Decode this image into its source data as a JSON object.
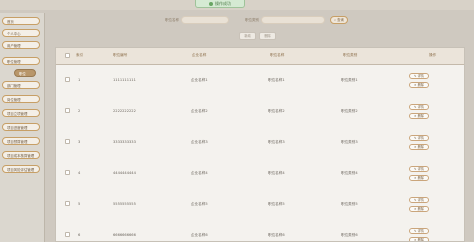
{
  "toast": {
    "message": "操作成功"
  },
  "sidebar": {
    "items": [
      {
        "label": "首页",
        "active": false
      },
      {
        "label": "个人中心",
        "active": false
      },
      {
        "label": "用户管理",
        "active": false
      },
      {
        "label": "职位管理",
        "active": false
      },
      {
        "label": "职位",
        "active": true
      },
      {
        "label": "部门管理",
        "active": false
      },
      {
        "label": "岗位管理",
        "active": false
      },
      {
        "label": "项目立项管理",
        "active": false
      },
      {
        "label": "项目进度管理",
        "active": false
      },
      {
        "label": "项目预算管理",
        "active": false
      },
      {
        "label": "项目成本核算管理",
        "active": false
      },
      {
        "label": "项目风险评估管理",
        "active": false
      }
    ]
  },
  "search": {
    "field1_label": "职位名称",
    "field2_label": "职位类别",
    "button_label": "查询"
  },
  "actions": {
    "add_label": "新增",
    "delete_label": "删除"
  },
  "table": {
    "headers": [
      "索引",
      "职位编号",
      "企业名称",
      "职位名称",
      "职位类别",
      "操作"
    ],
    "rows": [
      {
        "index": "1",
        "code": "1111111111",
        "company": "企业名称1",
        "position": "职位名称1",
        "category": "职位类别1"
      },
      {
        "index": "2",
        "code": "2222222222",
        "company": "企业名称2",
        "position": "职位名称2",
        "category": "职位类别2"
      },
      {
        "index": "3",
        "code": "3333333333",
        "company": "企业名称3",
        "position": "职位名称3",
        "category": "职位类别3"
      },
      {
        "index": "4",
        "code": "4444444444",
        "company": "企业名称4",
        "position": "职位名称4",
        "category": "职位类别4"
      },
      {
        "index": "5",
        "code": "5555555555",
        "company": "企业名称5",
        "position": "职位名称5",
        "category": "职位类别5"
      },
      {
        "index": "6",
        "code": "6666666666",
        "company": "企业名称6",
        "position": "职位名称6",
        "category": "职位类别6"
      }
    ],
    "edit_label": "详情",
    "delete_label": "删除"
  }
}
